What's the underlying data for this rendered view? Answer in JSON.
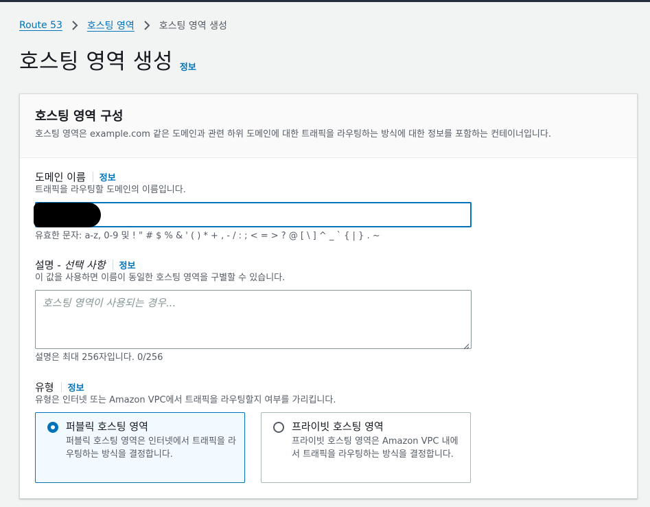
{
  "breadcrumb": {
    "items": [
      {
        "label": "Route 53"
      },
      {
        "label": "호스팅 영역"
      },
      {
        "label": "호스팅 영역 생성"
      }
    ]
  },
  "page": {
    "title": "호스팅 영역 생성",
    "info_link": "정보"
  },
  "panel": {
    "title": "호스팅 영역 구성",
    "description": "호스팅 영역은 example.com 같은 도메인과 관련 하위 도메인에 대한 트래픽을 라우팅하는 방식에 대한 정보를 포함하는 컨테이너입니다."
  },
  "domain_name": {
    "label": "도메인 이름",
    "info_link": "정보",
    "description": "트래픽을 라우팅할 도메인의 이름입니다.",
    "value": "",
    "constraint": "유효한 문자: a-z, 0-9 및 ! \" # $ % & ' ( ) * + , - / : ; < = > ? @ [ \\ ] ^ _ ` { | } . ~"
  },
  "description_field": {
    "label": "설명 - ",
    "label_optional": "선택 사항",
    "info_link": "정보",
    "description": "이 값을 사용하면 이름이 동일한 호스팅 영역을 구별할 수 있습니다.",
    "placeholder": "호스팅 영역이 사용되는 경우...",
    "constraint": "설명은 최대 256자입니다. 0/256"
  },
  "type_field": {
    "label": "유형",
    "info_link": "정보",
    "description": "유형은 인터넷 또는 Amazon VPC에서 트래픽을 라우팅할지 여부를 가리킵니다.",
    "options": [
      {
        "title": "퍼블릭 호스팅 영역",
        "description": "퍼블릭 호스팅 영역은 인터넷에서 트래픽을 라우팅하는 방식을 결정합니다.",
        "selected": true
      },
      {
        "title": "프라이빗 호스팅 영역",
        "description": "프라이빗 호스팅 영역은 Amazon VPC 내에서 트래픽을 라우팅하는 방식을 결정합니다.",
        "selected": false
      }
    ]
  },
  "colors": {
    "link": "#0073bb",
    "text": "#16191f",
    "secondary_text": "#545b64",
    "background": "#f2f3f3",
    "selected_tile_bg": "#f1faff"
  }
}
